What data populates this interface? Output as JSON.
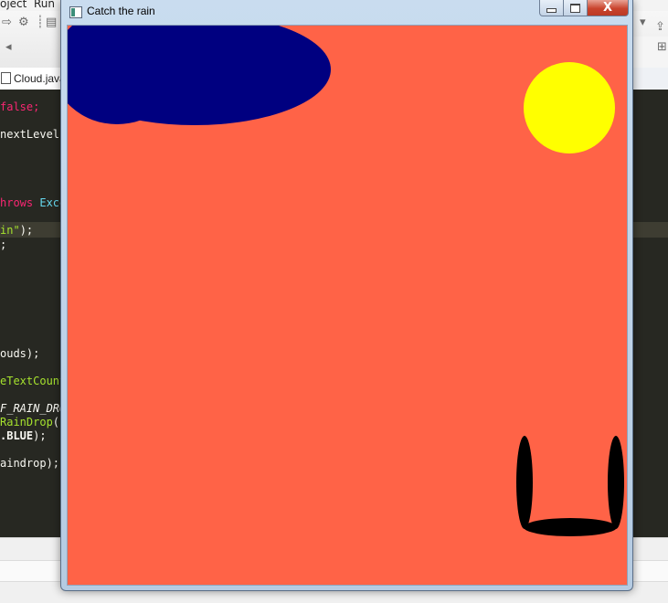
{
  "ide": {
    "menu": [
      "oject",
      "Run"
    ],
    "open_tab": "Cloud.java",
    "code_lines": [
      {
        "segments": [
          [
            "kw",
            "false;"
          ]
        ]
      },
      {
        "segments": [
          [
            "",
            "nextLevel"
          ]
        ]
      },
      {
        "segments": [
          [
            "kw",
            "hrows "
          ],
          [
            "ty",
            "Exce"
          ]
        ]
      },
      {
        "segments": [
          [
            "fn",
            "in\""
          ],
          [
            "",
            ");"
          ]
        ]
      },
      {
        "segments": [
          [
            "",
            ";"
          ]
        ]
      },
      {
        "segments": [
          [
            "",
            "ouds);"
          ]
        ]
      },
      {
        "segments": [
          [
            "fn",
            "eTextCount"
          ]
        ]
      },
      {
        "segments": [
          [
            "it",
            "F_RAIN_DRO"
          ]
        ]
      },
      {
        "segments": [
          [
            "fn",
            "RainDrop"
          ],
          [
            "",
            "(("
          ]
        ]
      },
      {
        "segments": [
          [
            "bold",
            ".BLUE"
          ],
          [
            "",
            ");"
          ]
        ]
      },
      {
        "segments": [
          [
            "",
            "aindrop);"
          ]
        ]
      }
    ]
  },
  "window": {
    "title": "Catch the rain",
    "close_symbol": "X"
  },
  "game": {
    "colors": {
      "background": "#FF6347",
      "cloud": "#000080",
      "sun": "#FFFF00",
      "bucket": "#000000"
    }
  }
}
